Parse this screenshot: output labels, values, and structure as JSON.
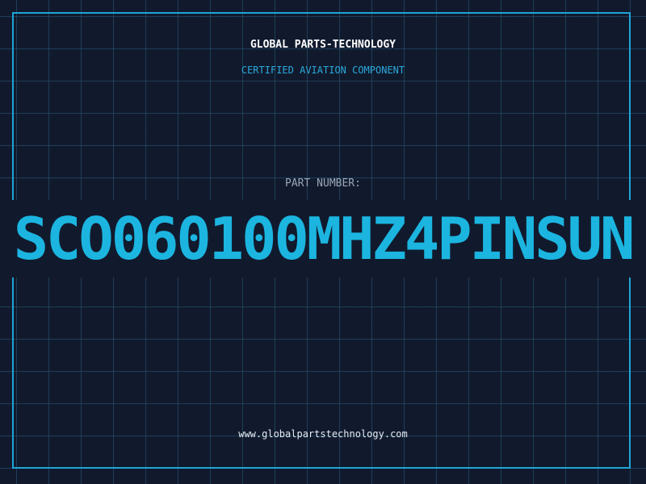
{
  "header": {
    "company": "GLOBAL PARTS-TECHNOLOGY",
    "subtitle": "CERTIFIED AVIATION COMPONENT"
  },
  "part": {
    "label": "PART NUMBER:",
    "number": "SCO060100MHZ4PINSUN"
  },
  "footer": {
    "url": "www.globalpartstechnology.com"
  },
  "colors": {
    "background": "#111a2d",
    "grid": "#285a78",
    "accent": "#1fa4d6",
    "part_number": "#1bb5e0"
  }
}
